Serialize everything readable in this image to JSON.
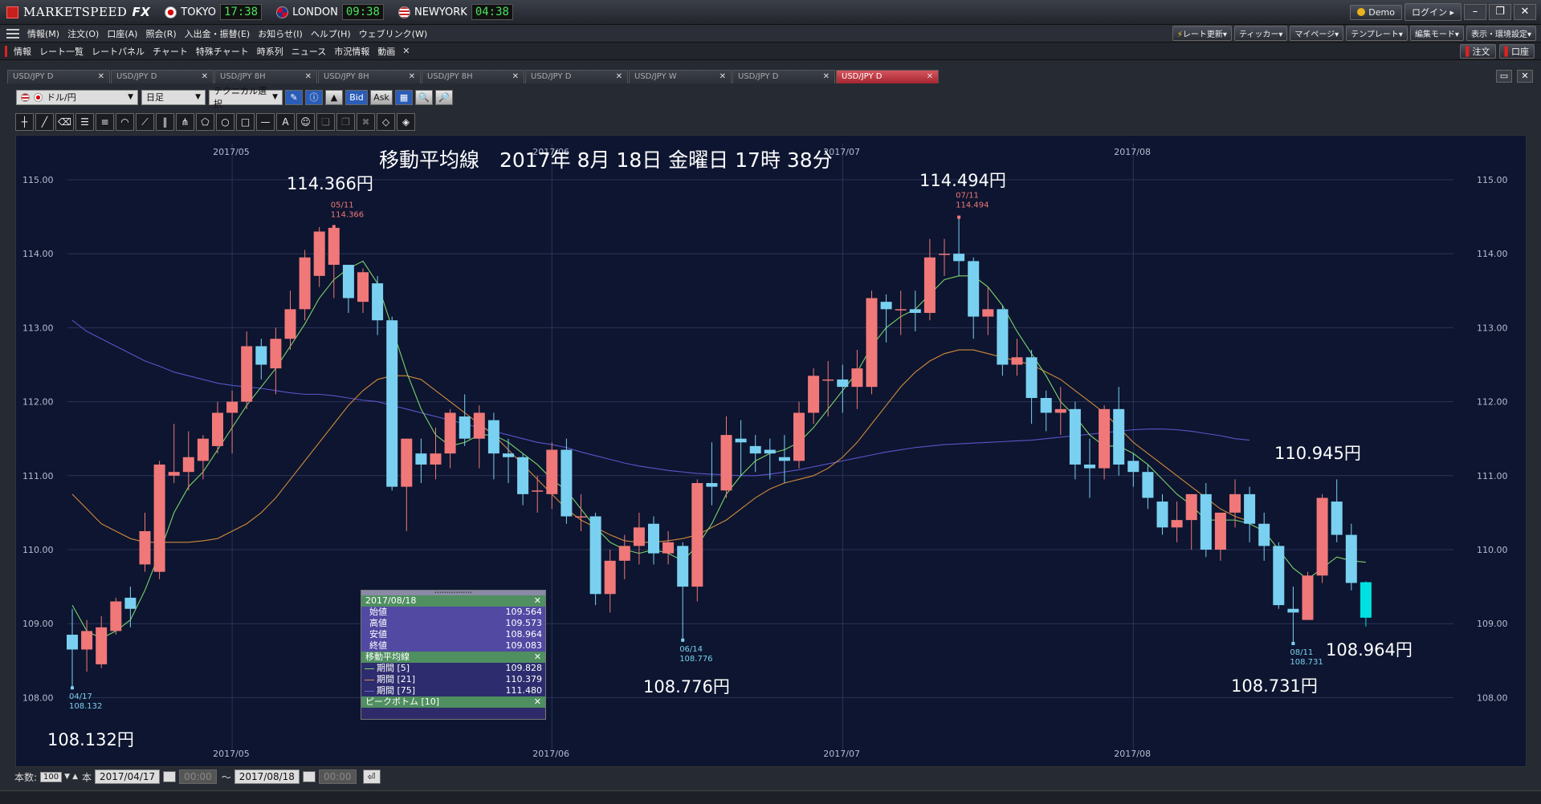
{
  "app": {
    "name": "MARKETSPEED",
    "name_bold": "FX",
    "clocks": [
      {
        "city": "TOKYO",
        "time": "17:38"
      },
      {
        "city": "LONDON",
        "time": "09:38"
      },
      {
        "city": "NEWYORK",
        "time": "04:38"
      }
    ],
    "demo_label": "Demo",
    "login_label": "ログイン"
  },
  "menu": {
    "items": [
      "情報(M)",
      "注文(O)",
      "口座(A)",
      "照会(R)",
      "入出金・振替(E)",
      "お知らせ(I)",
      "ヘルプ(H)",
      "ウェブリンク(W)"
    ],
    "right": [
      "レート更新▾",
      "ティッカー▾",
      "マイページ▾",
      "テンプレート▾",
      "編集モード▾",
      "表示・環境設定▾"
    ]
  },
  "toolbar": {
    "items": [
      "情報",
      "レート一覧",
      "レートパネル",
      "チャート",
      "特殊チャート",
      "時系列",
      "ニュース",
      "市況情報",
      "動画"
    ],
    "order_label": "注文",
    "account_label": "口座"
  },
  "tabs": [
    "USD/JPY D",
    "USD/JPY D",
    "USD/JPY 8H",
    "USD/JPY 8H",
    "USD/JPY 8H",
    "USD/JPY D",
    "USD/JPY W",
    "USD/JPY D",
    "USD/JPY D"
  ],
  "active_tab": 8,
  "chart_controls": {
    "pair": "ドル/円",
    "timeframe": "日足",
    "technical": "テクニカル選択",
    "bid": "Bid",
    "ask": "Ask"
  },
  "overlay_title": "移動平均線　2017年 8月 18日 金曜日 17時 38分",
  "annotations": [
    {
      "id": "a1",
      "text": "114.366円"
    },
    {
      "id": "a2",
      "text": "114.494円"
    },
    {
      "id": "a3",
      "text": "110.945円"
    },
    {
      "id": "a4",
      "text": "108.964円"
    },
    {
      "id": "a5",
      "text": "108.776円"
    },
    {
      "id": "a6",
      "text": "108.731円"
    },
    {
      "id": "a7",
      "text": "108.132円"
    }
  ],
  "info_panel": {
    "date": "2017/08/18",
    "rows": [
      {
        "label": "始値",
        "value": "109.564"
      },
      {
        "label": "高値",
        "value": "109.573"
      },
      {
        "label": "安値",
        "value": "108.964"
      },
      {
        "label": "終値",
        "value": "109.083"
      }
    ],
    "ma_title": "移動平均線",
    "ma_rows": [
      {
        "label": "期間 [5]",
        "value": "109.828",
        "color": "#7bd36a"
      },
      {
        "label": "期間 [21]",
        "value": "110.379",
        "color": "#d89040"
      },
      {
        "label": "期間 [75]",
        "value": "111.480",
        "color": "#6a64d8"
      }
    ],
    "peak_title": "ピークボトム [10]"
  },
  "bottom": {
    "count_label": "本数:",
    "count_value": "100",
    "unit": "本",
    "from_date": "2017/04/17",
    "to_date": "2017/08/18",
    "time_placeholder": "00:00",
    "tilde": "～"
  },
  "chart_data": {
    "type": "candlestick",
    "y_ticks": [
      "115.00",
      "114.00",
      "113.00",
      "112.00",
      "111.00",
      "110.00",
      "109.00",
      "108.00"
    ],
    "x_ticks": [
      "2017/05",
      "2017/06",
      "2017/07",
      "2017/08"
    ],
    "ylim": [
      107.6,
      115.6
    ],
    "up_color": "#f07878",
    "down_color": "#7ad0f0",
    "last_color": "#00e0e0",
    "candles": [
      [
        108.85,
        108.65,
        109.2,
        108.13
      ],
      [
        108.65,
        108.9,
        109.05,
        108.35
      ],
      [
        108.45,
        108.95,
        109.1,
        108.4
      ],
      [
        108.9,
        109.3,
        109.35,
        108.85
      ],
      [
        109.35,
        109.2,
        109.5,
        108.95
      ],
      [
        109.8,
        110.25,
        110.5,
        109.7
      ],
      [
        109.7,
        111.15,
        111.2,
        109.6
      ],
      [
        111.0,
        111.05,
        111.7,
        110.9
      ],
      [
        111.05,
        111.25,
        111.6,
        110.8
      ],
      [
        111.2,
        111.5,
        111.55,
        110.95
      ],
      [
        111.4,
        111.85,
        112.0,
        111.3
      ],
      [
        111.85,
        112.0,
        112.15,
        111.3
      ],
      [
        112.0,
        112.75,
        112.95,
        111.9
      ],
      [
        112.75,
        112.5,
        112.85,
        112.3
      ],
      [
        112.45,
        112.85,
        113.0,
        112.1
      ],
      [
        112.85,
        113.25,
        113.5,
        112.7
      ],
      [
        113.25,
        113.95,
        114.05,
        113.1
      ],
      [
        113.7,
        114.3,
        114.36,
        113.55
      ],
      [
        113.85,
        114.35,
        114.37,
        113.4
      ],
      [
        113.85,
        113.4,
        113.8,
        113.2
      ],
      [
        113.35,
        113.75,
        113.8,
        113.2
      ],
      [
        113.6,
        113.1,
        113.7,
        112.9
      ],
      [
        113.1,
        110.85,
        113.15,
        110.8
      ],
      [
        110.85,
        111.5,
        111.5,
        110.25
      ],
      [
        111.3,
        111.15,
        111.5,
        110.9
      ],
      [
        111.15,
        111.3,
        111.65,
        110.95
      ],
      [
        111.3,
        111.85,
        111.9,
        111.1
      ],
      [
        111.8,
        111.5,
        112.1,
        111.4
      ],
      [
        111.5,
        111.85,
        111.95,
        111.1
      ],
      [
        111.75,
        111.3,
        111.85,
        110.95
      ],
      [
        111.3,
        111.25,
        111.5,
        110.9
      ],
      [
        111.25,
        110.75,
        111.3,
        110.6
      ],
      [
        110.8,
        110.8,
        111.0,
        110.5
      ],
      [
        110.75,
        111.35,
        111.45,
        110.55
      ],
      [
        111.35,
        110.45,
        111.5,
        110.35
      ],
      [
        110.45,
        110.45,
        110.75,
        110.25
      ],
      [
        110.45,
        109.4,
        110.5,
        109.25
      ],
      [
        109.4,
        109.85,
        110.0,
        109.15
      ],
      [
        109.85,
        110.05,
        110.2,
        109.6
      ],
      [
        110.05,
        110.3,
        110.5,
        109.8
      ],
      [
        110.35,
        109.95,
        110.45,
        109.8
      ],
      [
        109.95,
        110.1,
        110.25,
        109.8
      ],
      [
        110.05,
        109.5,
        110.1,
        108.78
      ],
      [
        109.5,
        110.9,
        110.95,
        109.3
      ],
      [
        110.9,
        110.85,
        111.45,
        110.6
      ],
      [
        110.8,
        111.55,
        111.8,
        110.7
      ],
      [
        111.5,
        111.45,
        111.75,
        111.0
      ],
      [
        111.4,
        111.3,
        111.55,
        111.05
      ],
      [
        111.35,
        111.3,
        111.5,
        110.95
      ],
      [
        111.25,
        111.2,
        111.55,
        110.9
      ],
      [
        111.2,
        111.85,
        112.0,
        111.1
      ],
      [
        111.85,
        112.35,
        112.45,
        111.7
      ],
      [
        112.3,
        112.3,
        112.55,
        111.8
      ],
      [
        112.3,
        112.2,
        112.5,
        111.85
      ],
      [
        112.2,
        112.45,
        112.7,
        111.9
      ],
      [
        112.2,
        113.4,
        113.5,
        112.1
      ],
      [
        113.35,
        113.25,
        113.45,
        112.8
      ],
      [
        113.25,
        113.25,
        113.5,
        112.9
      ],
      [
        113.25,
        113.2,
        113.5,
        112.95
      ],
      [
        113.2,
        113.95,
        114.2,
        113.1
      ],
      [
        114.0,
        114.0,
        114.2,
        113.7
      ],
      [
        114.0,
        113.9,
        114.49,
        113.7
      ],
      [
        113.9,
        113.15,
        113.95,
        112.85
      ],
      [
        113.15,
        113.25,
        113.55,
        112.9
      ],
      [
        113.25,
        112.5,
        113.3,
        112.35
      ],
      [
        112.5,
        112.6,
        112.85,
        112.35
      ],
      [
        112.6,
        112.05,
        112.7,
        111.7
      ],
      [
        112.05,
        111.85,
        112.15,
        111.6
      ],
      [
        111.85,
        111.9,
        112.2,
        111.55
      ],
      [
        111.9,
        111.15,
        112.0,
        110.95
      ],
      [
        111.15,
        111.1,
        111.5,
        110.7
      ],
      [
        111.1,
        111.9,
        111.95,
        110.95
      ],
      [
        111.9,
        111.15,
        112.2,
        111.0
      ],
      [
        111.2,
        111.05,
        111.3,
        110.85
      ],
      [
        111.05,
        110.7,
        111.15,
        110.55
      ],
      [
        110.65,
        110.3,
        110.75,
        110.2
      ],
      [
        110.3,
        110.4,
        110.65,
        110.1
      ],
      [
        110.4,
        110.75,
        110.75,
        110.0
      ],
      [
        110.75,
        110.0,
        110.9,
        109.9
      ],
      [
        110.0,
        110.5,
        110.5,
        109.85
      ],
      [
        110.5,
        110.75,
        110.95,
        110.3
      ],
      [
        110.75,
        110.35,
        110.85,
        110.1
      ],
      [
        110.35,
        110.05,
        110.5,
        109.85
      ],
      [
        110.05,
        109.25,
        110.1,
        109.2
      ],
      [
        109.2,
        109.15,
        109.5,
        108.73
      ],
      [
        109.05,
        109.65,
        109.7,
        109.05
      ],
      [
        109.65,
        110.7,
        110.75,
        109.55
      ],
      [
        110.65,
        110.2,
        110.95,
        110.1
      ],
      [
        110.2,
        109.55,
        110.35,
        109.45
      ],
      [
        109.56,
        109.08,
        109.57,
        108.96
      ]
    ],
    "ma5": [
      109.25,
      108.9,
      108.8,
      108.9,
      109.05,
      109.45,
      109.95,
      110.5,
      110.85,
      111.05,
      111.35,
      111.65,
      111.95,
      112.2,
      112.45,
      112.75,
      113.05,
      113.4,
      113.65,
      113.8,
      113.9,
      113.6,
      113.0,
      112.4,
      111.9,
      111.55,
      111.4,
      111.45,
      111.55,
      111.55,
      111.45,
      111.3,
      111.15,
      110.95,
      110.8,
      110.55,
      110.3,
      110.1,
      110.0,
      109.95,
      110.0,
      109.95,
      109.85,
      110.05,
      110.35,
      110.75,
      111.0,
      111.2,
      111.3,
      111.35,
      111.45,
      111.65,
      111.9,
      112.15,
      112.4,
      112.75,
      113.0,
      113.15,
      113.25,
      113.45,
      113.65,
      113.7,
      113.7,
      113.55,
      113.3,
      112.95,
      112.65,
      112.35,
      112.0,
      111.8,
      111.55,
      111.4,
      111.4,
      111.3,
      111.15,
      110.95,
      110.75,
      110.6,
      110.4,
      110.4,
      110.4,
      110.35,
      110.25,
      110.0,
      109.75,
      109.6,
      109.75,
      109.9,
      109.85,
      109.83
    ],
    "ma21": [
      110.75,
      110.55,
      110.35,
      110.25,
      110.15,
      110.1,
      110.1,
      110.1,
      110.1,
      110.12,
      110.15,
      110.25,
      110.35,
      110.5,
      110.7,
      110.95,
      111.2,
      111.45,
      111.7,
      111.95,
      112.15,
      112.3,
      112.35,
      112.35,
      112.3,
      112.15,
      112.0,
      111.85,
      111.7,
      111.55,
      111.35,
      111.15,
      110.95,
      110.75,
      110.55,
      110.4,
      110.3,
      110.2,
      110.12,
      110.1,
      110.1,
      110.12,
      110.15,
      110.2,
      110.3,
      110.4,
      110.55,
      110.7,
      110.82,
      110.9,
      110.95,
      111.0,
      111.1,
      111.25,
      111.45,
      111.7,
      111.95,
      112.2,
      112.4,
      112.55,
      112.65,
      112.7,
      112.7,
      112.65,
      112.6,
      112.55,
      112.5,
      112.4,
      112.3,
      112.15,
      112.0,
      111.85,
      111.65,
      111.45,
      111.3,
      111.15,
      111.0,
      110.85,
      110.7,
      110.55,
      110.45,
      110.38
    ],
    "ma75": [
      113.1,
      112.95,
      112.85,
      112.75,
      112.65,
      112.55,
      112.48,
      112.4,
      112.35,
      112.3,
      112.25,
      112.22,
      112.2,
      112.18,
      112.15,
      112.12,
      112.1,
      112.1,
      112.08,
      112.05,
      112.02,
      112.0,
      111.95,
      111.9,
      111.85,
      111.8,
      111.75,
      111.7,
      111.65,
      111.6,
      111.55,
      111.5,
      111.45,
      111.42,
      111.38,
      111.32,
      111.27,
      111.22,
      111.17,
      111.13,
      111.1,
      111.07,
      111.05,
      111.03,
      111.02,
      111.01,
      111.0,
      111.0,
      111.02,
      111.05,
      111.08,
      111.12,
      111.16,
      111.2,
      111.24,
      111.28,
      111.32,
      111.35,
      111.38,
      111.4,
      111.42,
      111.43,
      111.44,
      111.45,
      111.46,
      111.47,
      111.48,
      111.5,
      111.52,
      111.54,
      111.56,
      111.58,
      111.6,
      111.62,
      111.63,
      111.63,
      111.62,
      111.6,
      111.57,
      111.54,
      111.5,
      111.48
    ]
  }
}
